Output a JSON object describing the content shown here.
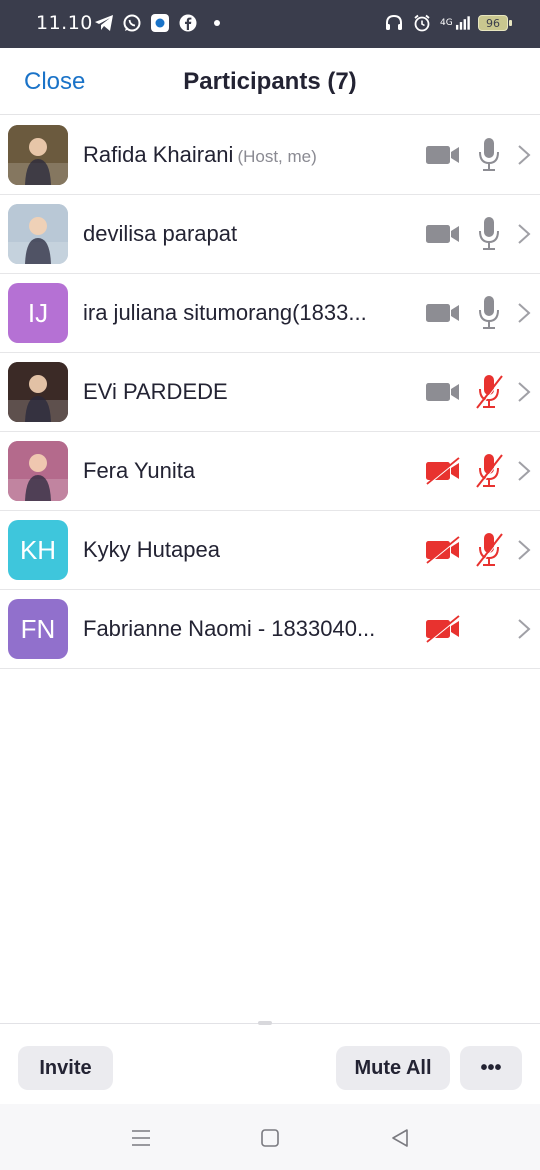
{
  "status_bar": {
    "time": "11.10",
    "network": "4G",
    "battery": "96",
    "icons_left": [
      "telegram-icon",
      "whatsapp-icon",
      "app-icon",
      "facebook-icon",
      "dot-icon"
    ],
    "icons_right": [
      "headphones-icon",
      "alarm-icon",
      "signal-icon",
      "battery-icon"
    ]
  },
  "header": {
    "close_label": "Close",
    "title": "Participants (7)"
  },
  "participants": [
    {
      "name": "Rafida Khairani",
      "role": "(Host, me)",
      "initials": "",
      "avatar_type": "photo",
      "avatar_color": "#6b5a3e",
      "video": "on",
      "audio": "on"
    },
    {
      "name": "devilisa parapat",
      "role": "",
      "initials": "",
      "avatar_type": "photo",
      "avatar_color": "#b9c8d6",
      "video": "on",
      "audio": "on"
    },
    {
      "name": "ira juliana situmorang(1833...",
      "role": "",
      "initials": "IJ",
      "avatar_type": "initials",
      "avatar_color": "#b571d4",
      "video": "on",
      "audio": "on"
    },
    {
      "name": "EVi PARDEDE",
      "role": "",
      "initials": "",
      "avatar_type": "photo",
      "avatar_color": "#3b2a26",
      "video": "on",
      "audio": "muted"
    },
    {
      "name": "Fera Yunita",
      "role": "",
      "initials": "",
      "avatar_type": "photo",
      "avatar_color": "#b46a8c",
      "video": "off",
      "audio": "muted"
    },
    {
      "name": "Kyky Hutapea",
      "role": "",
      "initials": "KH",
      "avatar_type": "initials",
      "avatar_color": "#3ec6dc",
      "video": "off",
      "audio": "muted"
    },
    {
      "name": "Fabrianne Naomi - 1833040...",
      "role": "",
      "initials": "FN",
      "avatar_type": "initials",
      "avatar_color": "#9170cc",
      "video": "off",
      "audio": "none"
    }
  ],
  "toolbar": {
    "invite_label": "Invite",
    "mute_all_label": "Mute All",
    "more_label": "•••"
  },
  "colors": {
    "accent": "#1a73c8",
    "muted_red": "#e8322f",
    "icon_gray": "#8d8d93",
    "status_bar_bg": "#3a3d4c"
  }
}
